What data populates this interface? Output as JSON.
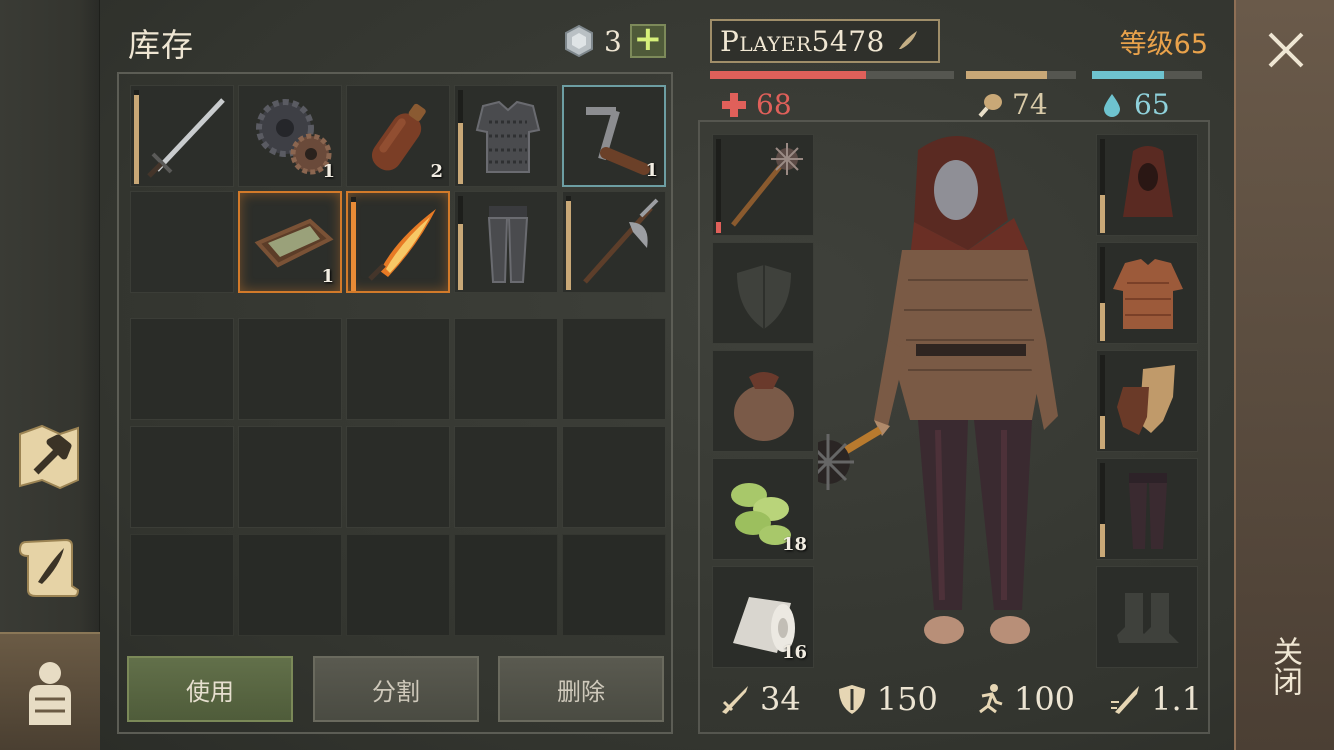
{
  "inventory": {
    "title": "库存",
    "gems": {
      "count": "3",
      "add_label": "+"
    },
    "items": [
      {
        "name": "longsword",
        "qty": "",
        "durability": 0.95
      },
      {
        "name": "gears",
        "qty": "1"
      },
      {
        "name": "leather-flask",
        "qty": "2"
      },
      {
        "name": "chainmail-armor",
        "qty": "",
        "durability": 0.65
      },
      {
        "name": "crank-handle",
        "qty": "1"
      },
      {
        "name": "",
        "qty": ""
      },
      {
        "name": "tray-frame",
        "qty": "1"
      },
      {
        "name": "flaming-sword",
        "qty": "",
        "durability": 0.95
      },
      {
        "name": "chainmail-leggings",
        "qty": "",
        "durability": 0.7
      },
      {
        "name": "halberd",
        "qty": "",
        "durability": 0.95
      }
    ],
    "buttons": {
      "use": "使用",
      "split": "分割",
      "delete": "删除"
    }
  },
  "player": {
    "name": "Player5478",
    "level_label": "等级65",
    "health": {
      "value": "68",
      "fraction": 0.64
    },
    "food": {
      "value": "74",
      "fraction": 0.74
    },
    "water": {
      "value": "65",
      "fraction": 0.65
    }
  },
  "equipment": {
    "left": [
      {
        "name": "spiked-mace",
        "qty": "",
        "durability": 0.12
      },
      {
        "name": "shield-placeholder",
        "qty": ""
      },
      {
        "name": "sack",
        "qty": ""
      },
      {
        "name": "herb-bundle",
        "qty": "18"
      },
      {
        "name": "cloth-roll",
        "qty": "16"
      }
    ],
    "right": [
      {
        "name": "hood",
        "durability": 0.4
      },
      {
        "name": "padded-jacket",
        "durability": 0.4
      },
      {
        "name": "leather-gloves",
        "durability": 0.35
      },
      {
        "name": "trousers",
        "durability": 0.35
      },
      {
        "name": "boots-placeholder"
      }
    ]
  },
  "combat_stats": {
    "attack": "34",
    "defense": "150",
    "speed": "100",
    "attack_speed": "1.1"
  },
  "close": {
    "label": "关闭"
  },
  "colors": {
    "health": "#e0605a",
    "food": "#c9a877",
    "water": "#6ec3cf",
    "level": "#e9a24b",
    "rare_border": "#d27a2a"
  }
}
